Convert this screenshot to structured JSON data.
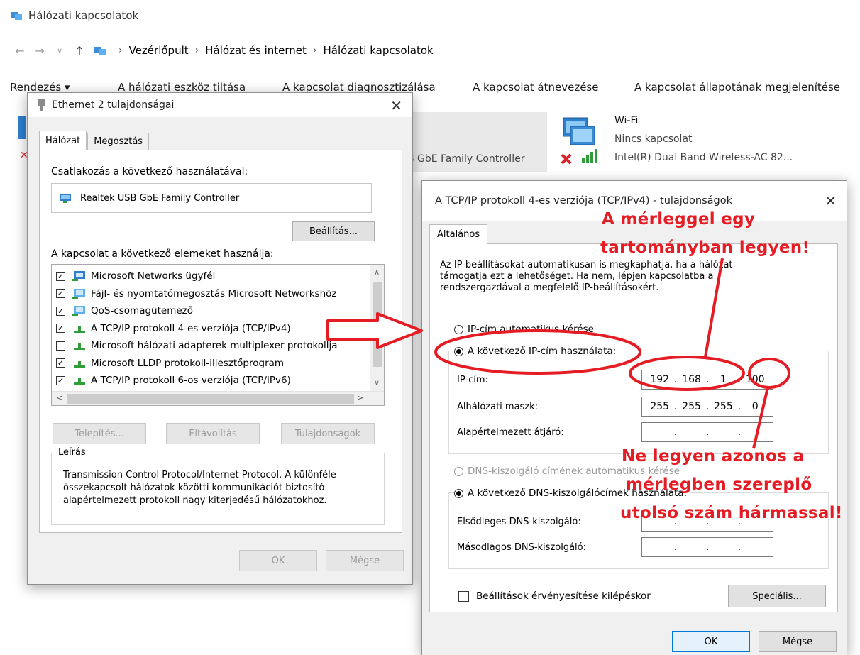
{
  "explorer": {
    "title": "Hálózati kapcsolatok",
    "breadcrumb": [
      "Vezérlőpult",
      "Hálózat és internet",
      "Hálózati kapcsolatok"
    ],
    "commands": [
      "Rendezés ▾",
      "A hálózati eszköz tiltása",
      "A kapcsolat diagnosztizálása",
      "A kapcsolat átnevezése",
      "A kapcsolat állapotának megjelenítése"
    ],
    "ethernet_partial_text": "B GbE Family Controller",
    "wifi": {
      "name": "Wi-Fi",
      "status": "Nincs kapcsolat",
      "device": "Intel(R) Dual Band Wireless-AC 82..."
    }
  },
  "ethernet_dialog": {
    "title": "Ethernet 2 tulajdonságai",
    "tabs": [
      "Hálózat",
      "Megosztás"
    ],
    "connect_label": "Csatlakozás a következő használatával:",
    "adapter_name": "Realtek USB GbE Family Controller",
    "configure_button": "Beállítás...",
    "items_label": "A kapcsolat a következő elemeket használja:",
    "items": [
      {
        "label": "Microsoft Networks ügyfél",
        "checked": true
      },
      {
        "label": "Fájl- és nyomtatómegosztás Microsoft Networkshöz",
        "checked": true
      },
      {
        "label": "QoS-csomagütemező",
        "checked": true
      },
      {
        "label": "A TCP/IP protokoll 4-es verziója (TCP/IPv4)",
        "checked": true
      },
      {
        "label": "Microsoft hálózati adapterek multiplexer protokollja",
        "checked": false
      },
      {
        "label": "Microsoft LLDP protokoll-illesztőprogram",
        "checked": true
      },
      {
        "label": "A TCP/IP protokoll 6-os verziója (TCP/IPv6)",
        "checked": true
      }
    ],
    "install_button": "Telepítés...",
    "uninstall_button": "Eltávolítás",
    "properties_button": "Tulajdonságok",
    "description_legend": "Leírás",
    "description_text": "Transmission Control Protocol/Internet Protocol. A különféle összekapcsolt hálózatok közötti kommunikációt biztosító alapértelmezett protokoll nagy kiterjedésű hálózatokhoz.",
    "ok_button": "OK",
    "cancel_button": "Mégse"
  },
  "tcp_dialog": {
    "title": "A TCP/IP protokoll 4-es verziója (TCP/IPv4) - tulajdonságok",
    "tab": "Általános",
    "intro_text": "Az IP-beállításokat automatikusan is megkaphatja, ha a hálózat támogatja ezt a lehetőséget. Ha nem, lépjen kapcsolatba a rendszergazdával a megfelelő IP-beállításokért.",
    "ip_auto_label": "IP-cím automatikus kérése",
    "ip_manual_label": "A következő IP-cím használata:",
    "ip_address_label": "IP-cím:",
    "ip_address": [
      "192",
      "168",
      "1",
      "100"
    ],
    "subnet_label": "Alhálózati maszk:",
    "subnet": [
      "255",
      "255",
      "255",
      "0"
    ],
    "gateway_label": "Alapértelmezett átjáró:",
    "gateway": [
      "",
      "",
      "",
      ""
    ],
    "dns_auto_label": "DNS-kiszolgáló címének automatikus kérése",
    "dns_manual_label": "A következő DNS-kiszolgálócímek használata:",
    "dns_primary_label": "Elsődleges DNS-kiszolgáló:",
    "dns_primary": [
      "",
      "",
      "",
      ""
    ],
    "dns_secondary_label": "Másodlagos DNS-kiszolgáló:",
    "dns_secondary": [
      "",
      "",
      "",
      ""
    ],
    "validate_label": "Beállítások érvényesítése kilépéskor",
    "advanced_button": "Speciális...",
    "ok_button": "OK",
    "cancel_button": "Mégse"
  },
  "annotations": {
    "note1_line1": "A mérleggel egy",
    "note1_line2": "tartományban legyen!",
    "note2_line1": "Ne legyen azonos a",
    "note2_line2": "mérlegben szereplő",
    "note2_line3": "utolsó szám hármassal!",
    "color": "#e51c23"
  }
}
